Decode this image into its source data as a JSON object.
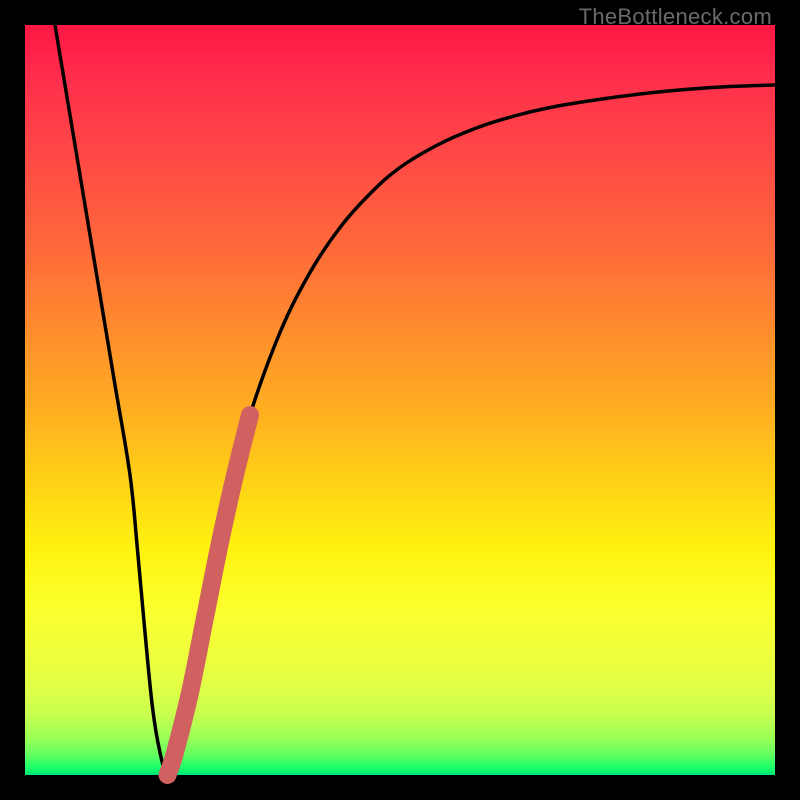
{
  "watermark": "TheBottleneck.com",
  "colors": {
    "background": "#000000",
    "curve_main": "#000000",
    "curve_highlight": "#d16161"
  },
  "chart_data": {
    "type": "line",
    "title": "",
    "xlabel": "",
    "ylabel": "",
    "xlim": [
      0,
      100
    ],
    "ylim": [
      0,
      100
    ],
    "series": [
      {
        "name": "bottleneck-curve",
        "x": [
          4,
          6,
          8,
          10,
          12,
          14,
          15,
          16,
          17,
          18,
          19,
          20,
          22,
          24,
          26,
          28,
          30,
          34,
          38,
          42,
          46,
          50,
          55,
          60,
          65,
          70,
          76,
          82,
          88,
          94,
          100
        ],
        "y": [
          100,
          88,
          76,
          64,
          52,
          40,
          30,
          19,
          9,
          3,
          0,
          3,
          11,
          21,
          31,
          40,
          48,
          59,
          67,
          73,
          77.5,
          81,
          84,
          86.2,
          87.8,
          89,
          90,
          90.8,
          91.4,
          91.8,
          92
        ]
      },
      {
        "name": "highlight-segment",
        "x": [
          19,
          20,
          22,
          24,
          26,
          28,
          30
        ],
        "y": [
          0,
          3,
          11,
          21,
          31,
          40,
          48
        ]
      }
    ],
    "legend": false,
    "grid": false
  }
}
